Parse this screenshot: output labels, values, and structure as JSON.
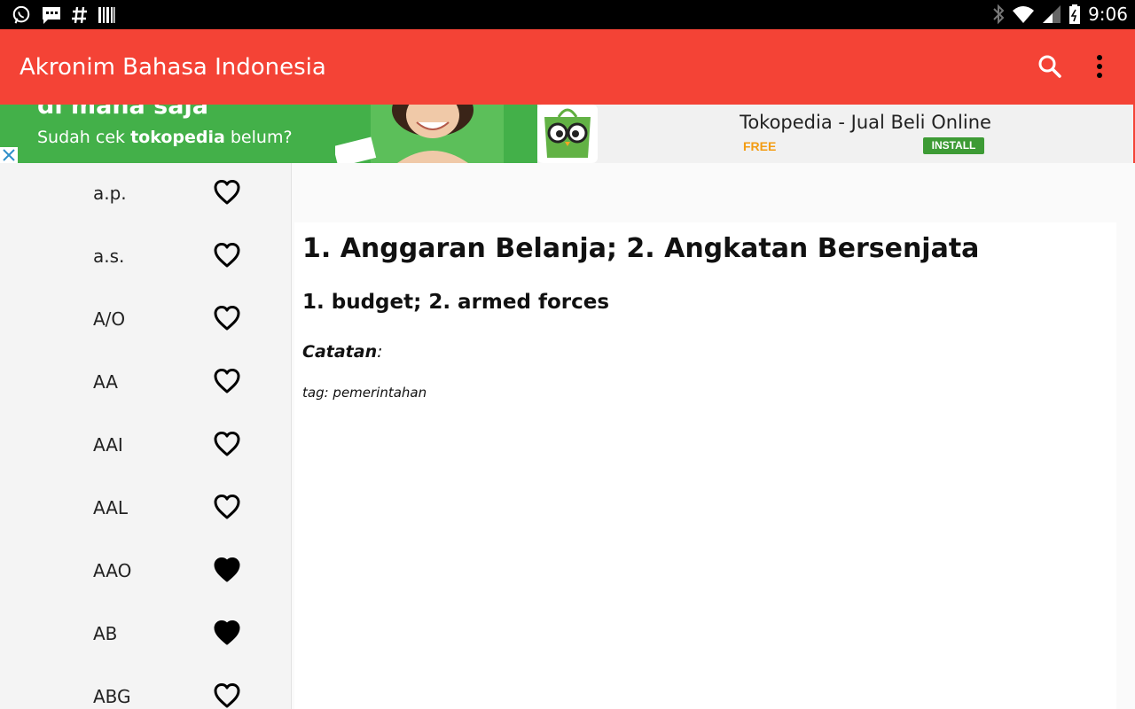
{
  "status_bar": {
    "time": "9:06",
    "left_icons": [
      "whatsapp-icon",
      "message-icon",
      "hashtag-icon",
      "barcode-icon"
    ],
    "right_icons": [
      "bluetooth-icon",
      "wifi-icon",
      "signal-icon",
      "battery-icon"
    ]
  },
  "app_bar": {
    "title": "Akronim Bahasa Indonesia",
    "color": "#f44336",
    "actions": [
      "search-icon",
      "more-vert-icon"
    ]
  },
  "ad": {
    "headline": "di mana saja",
    "tagline_prefix": "Sudah cek ",
    "tagline_brand": "tokopedia",
    "tagline_suffix": " belum?",
    "app_name": "Tokopedia - Jual Beli Online",
    "price": "FREE",
    "install_label": "INSTALL",
    "banner_color": "#43b049"
  },
  "acronym_list": {
    "items": [
      {
        "label": "a.p.",
        "favorite": false
      },
      {
        "label": "a.s.",
        "favorite": false
      },
      {
        "label": "A/O",
        "favorite": false
      },
      {
        "label": "AA",
        "favorite": false
      },
      {
        "label": "AAI",
        "favorite": false
      },
      {
        "label": "AAL",
        "favorite": false
      },
      {
        "label": "AAO",
        "favorite": true
      },
      {
        "label": "AB",
        "favorite": true
      },
      {
        "label": "ABG",
        "favorite": false
      }
    ]
  },
  "detail": {
    "meaning": "1. Anggaran Belanja; 2. Angkatan Bersenjata",
    "english": "1. budget; 2. armed forces",
    "note_label": "Catatan",
    "note_suffix": ":",
    "tag": "tag: pemerintahan"
  }
}
